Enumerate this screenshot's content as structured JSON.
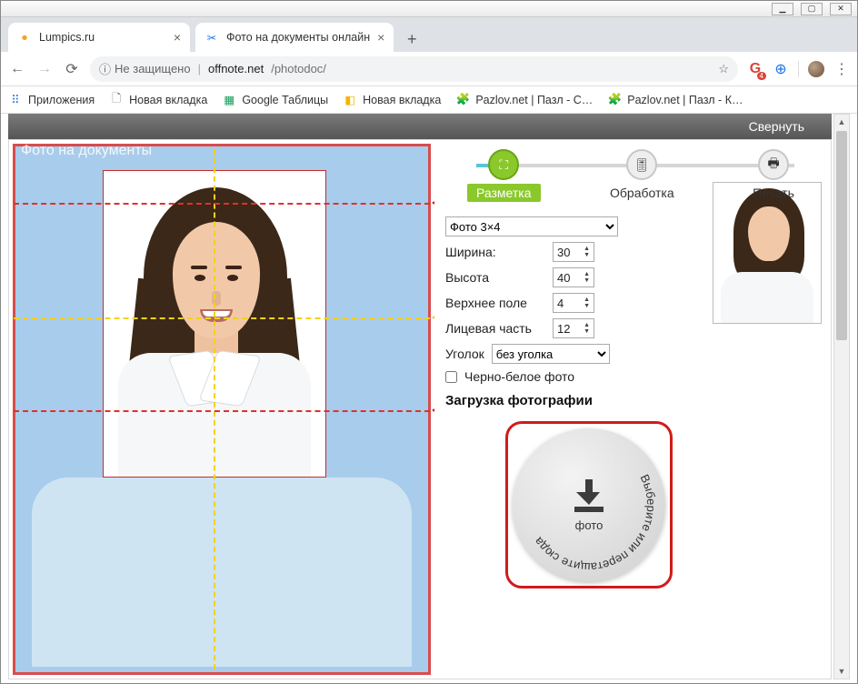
{
  "window": {
    "min": "▁",
    "max": "▢",
    "close": "✕"
  },
  "tabs": [
    {
      "title": "Lumpics.ru",
      "favicon": "●",
      "favicon_color": "#f6a22a"
    },
    {
      "title": "Фото на документы онлайн",
      "favicon": "✂",
      "favicon_color": "#1a73e8"
    }
  ],
  "newtab": "+",
  "nav": {
    "back": "←",
    "forward": "→",
    "reload": "⟳"
  },
  "omnibox": {
    "info_icon": "ⓘ",
    "secure_text": "Не защищено",
    "host": "offnote.net",
    "path": "/photodoc/",
    "star": "☆"
  },
  "addr_icons": {
    "ext1": "G",
    "ext1_badge": "4",
    "ext2": "⊕",
    "menu": "⋮"
  },
  "bookmarks": [
    {
      "icon": "⠿",
      "label": "Приложения",
      "color": "#2b7de9"
    },
    {
      "icon": "🗋",
      "label": "Новая вкладка",
      "color": "#666"
    },
    {
      "icon": "▦",
      "label": "Google Таблицы",
      "color": "#0f9d58"
    },
    {
      "icon": "◧",
      "label": "Новая вкладка",
      "color": "#f4b400"
    },
    {
      "icon": "🧩",
      "label": "Pazlov.net | Пазл - С…",
      "color": "#2b7de9"
    },
    {
      "icon": "🧩",
      "label": "Pazlov.net | Пазл - К…",
      "color": "#2b7de9"
    }
  ],
  "greybar": {
    "collapse": "Свернуть"
  },
  "page_title": "Фото на документы",
  "steps": [
    {
      "label": "Разметка",
      "icon": "⛶",
      "active": true
    },
    {
      "label": "Обработка",
      "icon": "🎚",
      "active": false
    },
    {
      "label": "Печать",
      "icon": "🖶",
      "active": false
    }
  ],
  "form": {
    "format_select": "Фото 3×4",
    "width_label": "Ширина:",
    "width_value": "30",
    "height_label": "Высота",
    "height_value": "40",
    "topfield_label": "Верхнее поле",
    "topfield_value": "4",
    "face_label": "Лицевая часть",
    "face_value": "12",
    "corner_label": "Уголок",
    "corner_select": "без уголка",
    "bw_label": "Черно-белое фото"
  },
  "upload": {
    "heading": "Загрузка фотографии",
    "ring_text": "Выберите или перетащите сюда",
    "caption": "фото"
  }
}
